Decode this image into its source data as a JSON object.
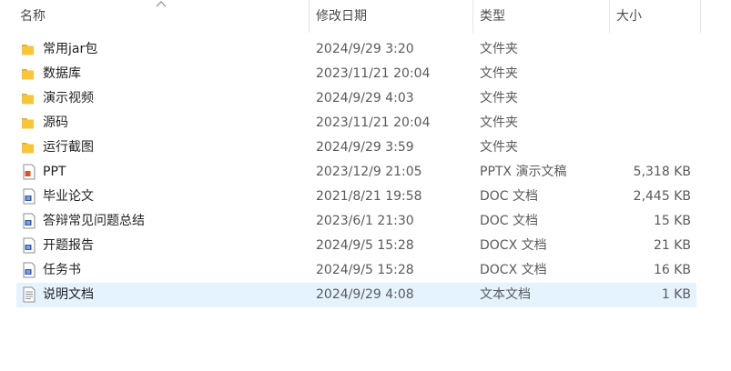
{
  "header": {
    "name_label": "名称",
    "date_label": "修改日期",
    "type_label": "类型",
    "size_label": "大小"
  },
  "colors": {
    "folder": "#f8c537",
    "folder_dark": "#e5a82a",
    "ppt": "#d9532b",
    "word": "#2b5fb3",
    "selection": "#e5f3ff"
  },
  "files": [
    {
      "name": "常用jar包",
      "date": "2024/9/29 3:20",
      "type": "文件夹",
      "size": "",
      "icon": "folder-icon"
    },
    {
      "name": "数据库",
      "date": "2023/11/21 20:04",
      "type": "文件夹",
      "size": "",
      "icon": "folder-icon"
    },
    {
      "name": "演示视频",
      "date": "2024/9/29 4:03",
      "type": "文件夹",
      "size": "",
      "icon": "folder-icon"
    },
    {
      "name": "源码",
      "date": "2023/11/21 20:04",
      "type": "文件夹",
      "size": "",
      "icon": "folder-icon"
    },
    {
      "name": "运行截图",
      "date": "2024/9/29 3:59",
      "type": "文件夹",
      "size": "",
      "icon": "folder-icon"
    },
    {
      "name": "PPT",
      "date": "2023/12/9 21:05",
      "type": "PPTX 演示文稿",
      "size": "5,318 KB",
      "icon": "pptx-file-icon"
    },
    {
      "name": "毕业论文",
      "date": "2021/8/21 19:58",
      "type": "DOC 文档",
      "size": "2,445 KB",
      "icon": "doc-file-icon"
    },
    {
      "name": "答辩常见问题总结",
      "date": "2023/6/1 21:30",
      "type": "DOC 文档",
      "size": "15 KB",
      "icon": "doc-file-icon"
    },
    {
      "name": "开题报告",
      "date": "2024/9/5 15:28",
      "type": "DOCX 文档",
      "size": "21 KB",
      "icon": "docx-file-icon"
    },
    {
      "name": "任务书",
      "date": "2024/9/5 15:28",
      "type": "DOCX 文档",
      "size": "16 KB",
      "icon": "docx-file-icon"
    },
    {
      "name": "说明文档",
      "date": "2024/9/29 4:08",
      "type": "文本文档",
      "size": "1 KB",
      "icon": "text-file-icon",
      "selected": true
    }
  ]
}
